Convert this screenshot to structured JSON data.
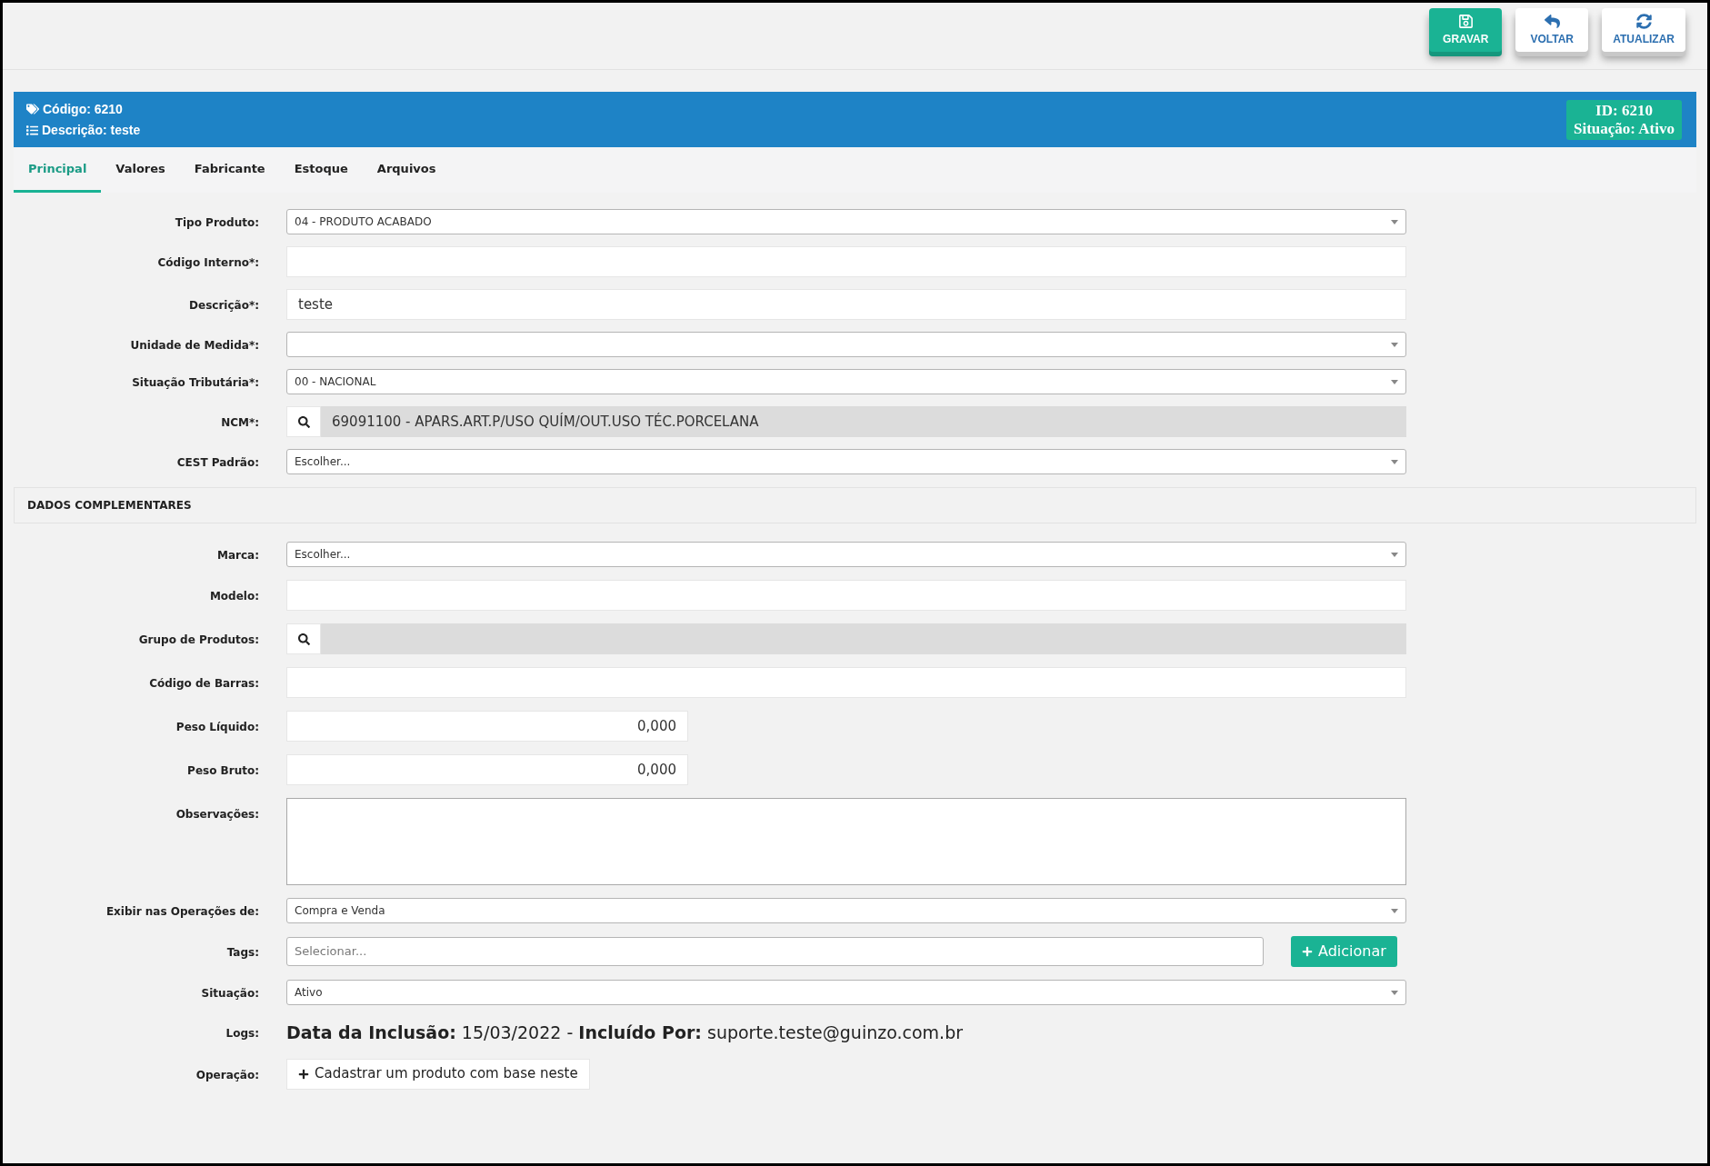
{
  "toolbar": [
    {
      "label": "GRAVAR",
      "kind": "save"
    },
    {
      "label": "VOLTAR",
      "kind": "back"
    },
    {
      "label": "ATUALIZAR",
      "kind": "refresh"
    }
  ],
  "header": {
    "code": "Código: 6210",
    "description": "Descrição: teste",
    "id": "ID: 6210",
    "status": "Situação: Ativo"
  },
  "tabs": [
    {
      "label": "Principal",
      "selected": true
    },
    {
      "label": "Valores",
      "selected": false
    },
    {
      "label": "Fabricante",
      "selected": false
    },
    {
      "label": "Estoque",
      "selected": false
    },
    {
      "label": "Arquivos",
      "selected": false
    }
  ],
  "main_fields": [
    {
      "label": "Tipo Produto:",
      "kind": "select",
      "value": "04 - PRODUTO ACABADO"
    },
    {
      "label": "Código Interno*:",
      "kind": "text"
    },
    {
      "label": "Descrição*:",
      "kind": "text",
      "value": "teste"
    },
    {
      "label": "Unidade de Medida*:",
      "kind": "select"
    },
    {
      "label": "Situação Tributária*:",
      "kind": "select",
      "value": "00 - NACIONAL"
    },
    {
      "label": "NCM*:",
      "kind": "search",
      "value": "69091100 - APARS.ART.P/USO QUÍM/OUT.USO TÉC.PORCELANA"
    },
    {
      "label": "CEST Padrão:",
      "kind": "select",
      "value": "Escolher..."
    }
  ],
  "section_title": "DADOS COMPLEMENTARES",
  "extra_fields": [
    {
      "label": "Marca:",
      "kind": "select",
      "value": "Escolher..."
    },
    {
      "label": "Modelo:",
      "kind": "text"
    },
    {
      "label": "Grupo de Produtos:",
      "kind": "search"
    },
    {
      "label": "Código de Barras:",
      "kind": "text"
    },
    {
      "label": "Peso Líquido:",
      "kind": "number",
      "value": "0,000"
    },
    {
      "label": "Peso Bruto:",
      "kind": "number",
      "value": "0,000"
    },
    {
      "label": "Observações:",
      "kind": "textarea"
    },
    {
      "label": "Exibir nas Operações de:",
      "kind": "select",
      "value": "Compra e Venda"
    },
    {
      "label": "Tags:",
      "kind": "tags",
      "placeholder": "Selecionar...",
      "button": "Adicionar"
    },
    {
      "label": "Situação:",
      "kind": "select",
      "value": "Ativo"
    },
    {
      "label": "Logs:",
      "kind": "info",
      "text": "**Data da Inclusão:** 15/03/2022 - **Incluído Por:** suporte.teste@guinzo.com.br"
    },
    {
      "label": "Operação:",
      "kind": "action",
      "button": "Cadastrar um produto com base neste"
    }
  ]
}
